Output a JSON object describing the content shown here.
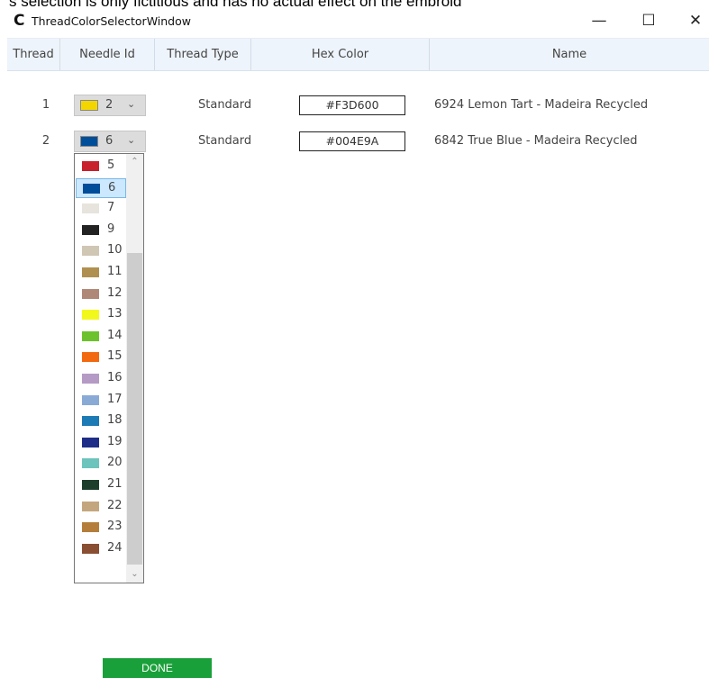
{
  "banner_text": "s selection is only fictitious and has no actual effect on the embroid",
  "window": {
    "title": "ThreadColorSelectorWindow",
    "app_icon_glyph": "C",
    "min_glyph": "—",
    "max_glyph": "☐",
    "close_glyph": "✕"
  },
  "columns": {
    "thread": "Thread",
    "needle_id": "Needle Id",
    "thread_type": "Thread Type",
    "hex_color": "Hex Color",
    "name": "Name"
  },
  "rows": [
    {
      "thread": "1",
      "needle": "2",
      "needle_color": "#F3D600",
      "type": "Standard",
      "hex": "#F3D600",
      "name": "6924 Lemon Tart - Madeira Recycled"
    },
    {
      "thread": "2",
      "needle": "6",
      "needle_color": "#004E9A",
      "type": "Standard",
      "hex": "#004E9A",
      "name": "6842 True Blue - Madeira Recycled"
    }
  ],
  "dropdown": {
    "selected": "6",
    "items": [
      {
        "label": "5",
        "color": "#C8202C"
      },
      {
        "label": "6",
        "color": "#004E9A"
      },
      {
        "label": "7",
        "color": "#E6E4DC"
      },
      {
        "label": "9",
        "color": "#222222"
      },
      {
        "label": "10",
        "color": "#CFC6B4"
      },
      {
        "label": "11",
        "color": "#B09050"
      },
      {
        "label": "12",
        "color": "#B08878"
      },
      {
        "label": "13",
        "color": "#F2F81C"
      },
      {
        "label": "14",
        "color": "#6CC22C"
      },
      {
        "label": "15",
        "color": "#F26A10"
      },
      {
        "label": "16",
        "color": "#B49AC4"
      },
      {
        "label": "17",
        "color": "#8AAAD6"
      },
      {
        "label": "18",
        "color": "#1C7AB4"
      },
      {
        "label": "19",
        "color": "#1E2E88"
      },
      {
        "label": "20",
        "color": "#6CC4BC"
      },
      {
        "label": "21",
        "color": "#1E3E2C"
      },
      {
        "label": "22",
        "color": "#C4A67E"
      },
      {
        "label": "23",
        "color": "#B47E3A"
      },
      {
        "label": "24",
        "color": "#8A4E32"
      }
    ]
  },
  "done_label": "DONE",
  "colors": {
    "header_bg": "#eef4fb",
    "done_bg": "#1aa03a",
    "selection_bg": "#cce8ff"
  }
}
